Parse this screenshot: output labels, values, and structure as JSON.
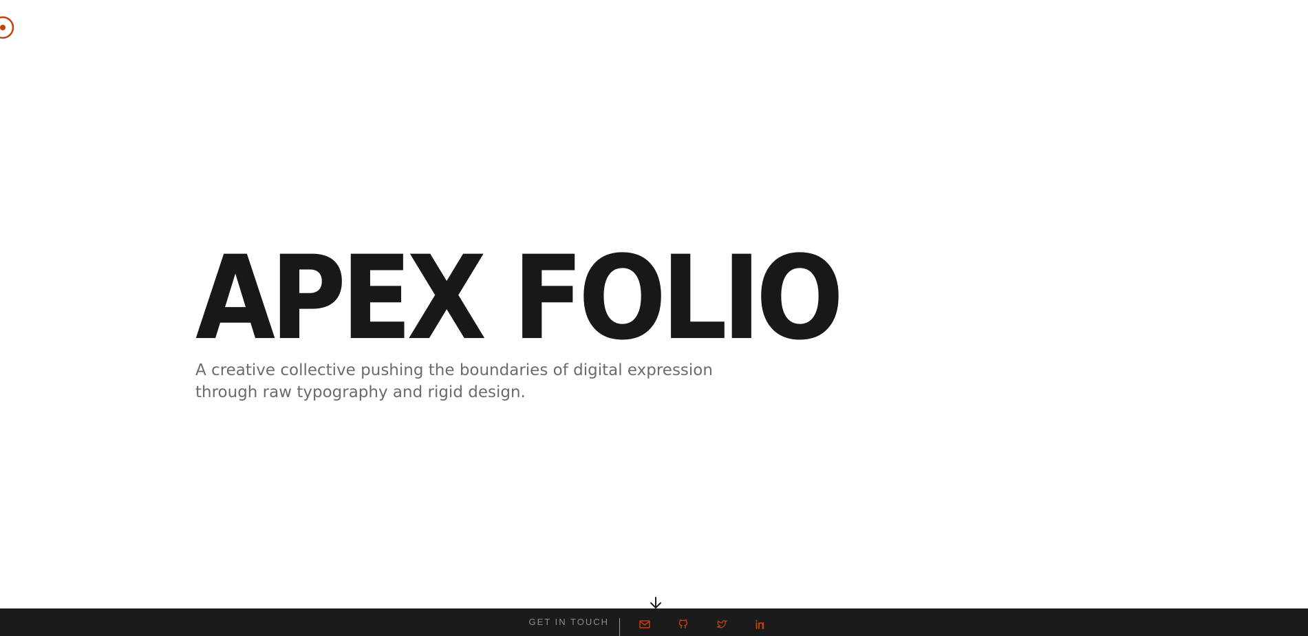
{
  "brand": {
    "logo_icon": "target-circle-icon",
    "accent_color": "#c2410c"
  },
  "hero": {
    "title": "APEX FOLIO",
    "subtitle_line1": "A creative collective pushing the boundaries of digital expression",
    "subtitle_line2": "through raw typography and rigid design."
  },
  "scroll": {
    "icon": "arrow-down-icon"
  },
  "footer": {
    "cta_label": "GET IN TOUCH",
    "background_color": "#1b1b1b",
    "social_icons": [
      "mail-icon",
      "github-icon",
      "twitter-icon",
      "linkedin-icon"
    ]
  }
}
